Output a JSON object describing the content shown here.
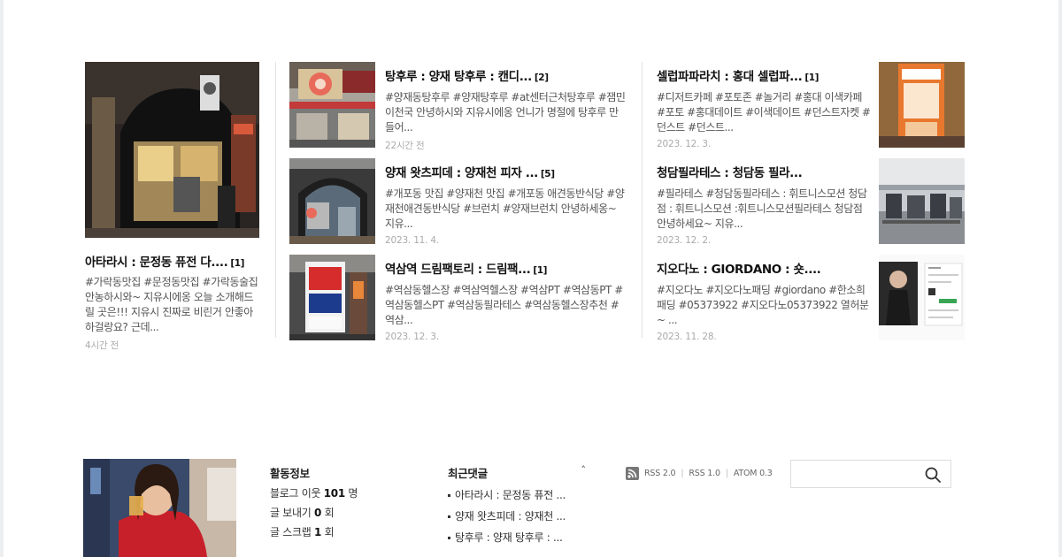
{
  "featured": {
    "title": "아타라시 : 문정동 퓨전 다....",
    "count": "[1]",
    "excerpt": "#가락동맛집 #문정동맛집 #가락동술집 안농하시와~ 지유시에옹 오늘 소개해드릴 곳은!!! 지유시 진짜로 비린거 안좋아하걸랑요? 근데...",
    "time": "4시간 전"
  },
  "middle_posts": [
    {
      "title": "탕후루 : 양재 탕후루 : 캔디...",
      "count": "[2]",
      "excerpt": "#양재동탕후루 #양재탕후루 #at센터근처탕후루 #잼민이천국 안녕하시와 지유시에옹 언니가 명절에 탕후루 만들어...",
      "time": "22시간 전"
    },
    {
      "title": "양재 왓츠피데 : 양재천 피자 ...",
      "count": "[5]",
      "excerpt": "#개포동 맛집 #양재천 맛집 #개포동 애견동반식당 #양재천애견동반식당 #브런치 #양재브런치 안녕하세옹~ 지유...",
      "time": "2023. 11. 4."
    },
    {
      "title": "역삼역 드림팩토리 : 드림팩...",
      "count": "[1]",
      "excerpt": "#역삼동헬스장 #역삼역헬스장 #역삼PT #역삼동PT #역삼동헬스PT #역삼동필라테스 #역삼동헬스장추천 #역삼...",
      "time": "2023. 12. 3."
    }
  ],
  "right_posts": [
    {
      "title": "셀럽파파라치 : 홍대 셀럽파...",
      "count": "[1]",
      "excerpt": "#디저트카페 #포토존 #놀거리 #홍대 이색카페 #포토 #홍대데이트 #이색데이트 #던스트자켓 #던스트 #던스트...",
      "time": "2023. 12. 3."
    },
    {
      "title": "청담필라테스 : 청담동 필라...",
      "count": "",
      "excerpt": "#필라테스 #청담동필라테스 : 휘트니스모션 청담점 : 휘트니스모션 :휘트니스모션필라테스 청담점 안녕하세요~ 지유...",
      "time": "2023. 12. 2."
    },
    {
      "title": "지오다노 : GIORDANO : 숏....",
      "count": "",
      "excerpt": "#지오다노 #지오다노패딩 #giordano #한소희패딩 #05373922 #지오다노05373922 열허분~ ...",
      "time": "2023. 11. 28."
    }
  ],
  "footer": {
    "activity": {
      "title": "활동정보",
      "neighbors_label": "블로그 이웃",
      "neighbors_value": "101",
      "neighbors_unit": "명",
      "sends_label": "글 보내기",
      "sends_value": "0",
      "sends_unit": "회",
      "scraps_label": "글 스크랩",
      "scraps_value": "1",
      "scraps_unit": "회"
    },
    "comments": {
      "title": "최근댓글",
      "caret": "˄",
      "items": [
        "아타라시 : 문정동 퓨전 ...",
        "양재 왓츠피데 : 양재천 ...",
        "탕후루 : 양재 탕후루 : ..."
      ]
    },
    "feeds": [
      "RSS 2.0",
      "RSS 1.0",
      "ATOM 0.3"
    ],
    "search": {
      "placeholder": "",
      "icon": "search-icon"
    }
  }
}
